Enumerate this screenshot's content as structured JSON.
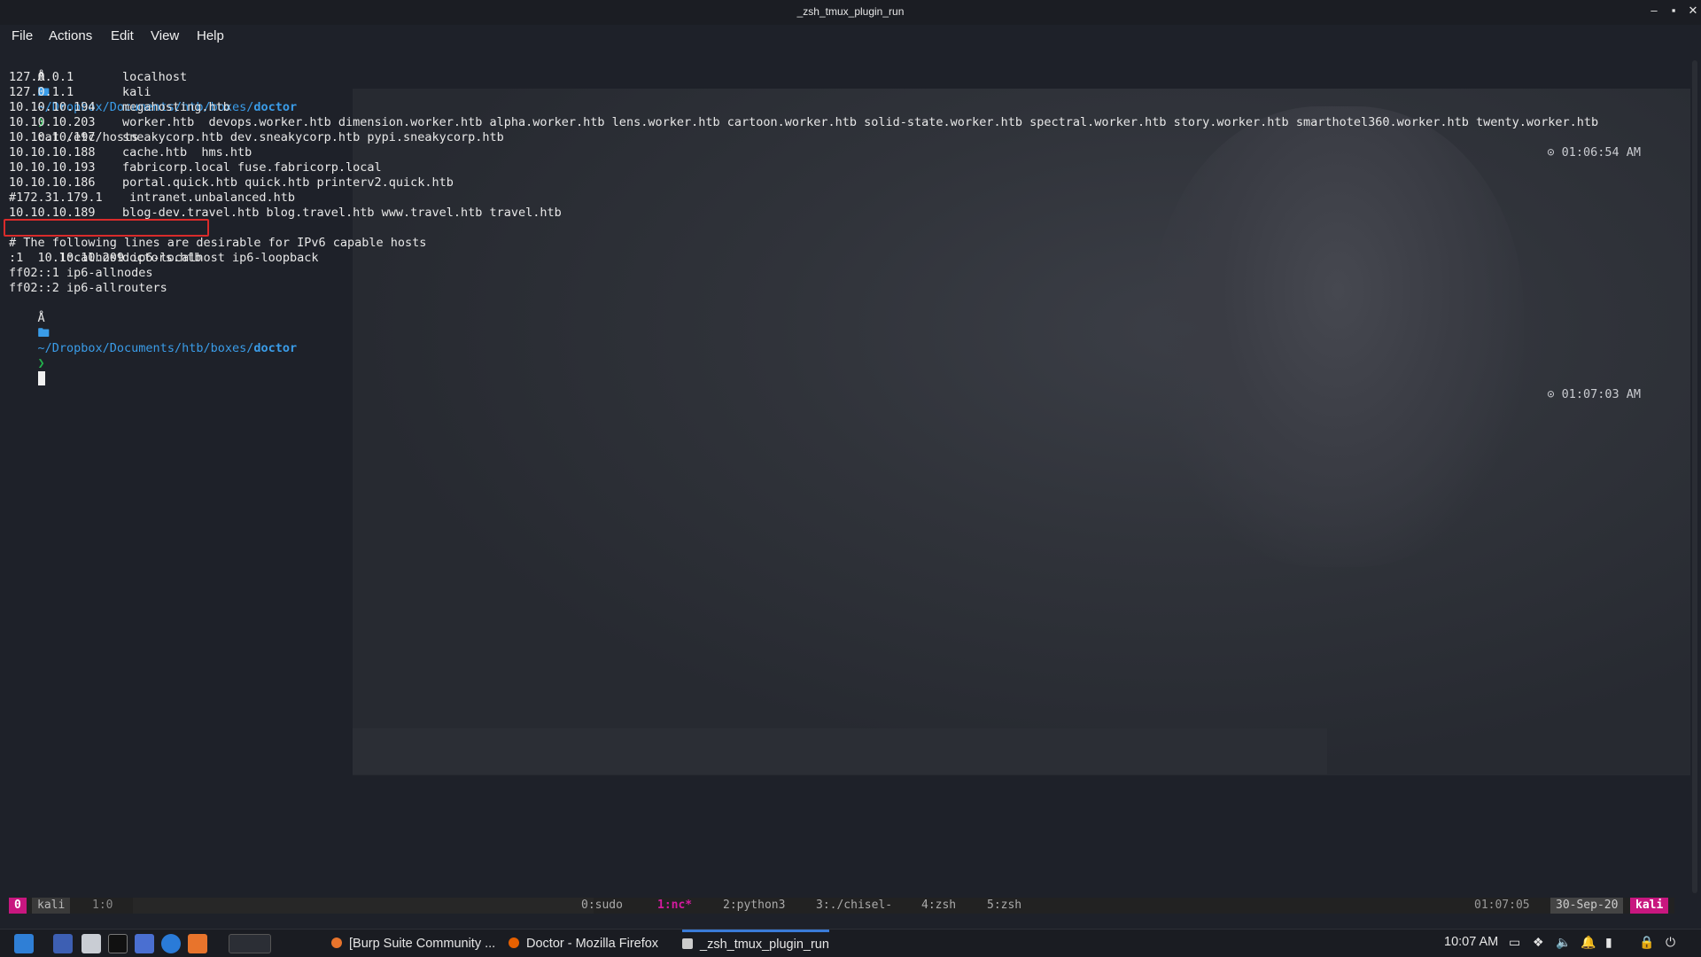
{
  "window": {
    "title": "_zsh_tmux_plugin_run"
  },
  "menu": [
    "File",
    "Actions",
    "Edit",
    "View",
    "Help"
  ],
  "terminal": {
    "prompt1": {
      "symbol": "Å",
      "path": "~/Dropbox/Documents/htb/boxes/",
      "dir": "doctor",
      "command": "cat /etc/hosts",
      "time": "⊙ 01:06:54 AM"
    },
    "hosts": [
      {
        "ip": "127.0.0.1",
        "names": "localhost"
      },
      {
        "ip": "127.0.1.1",
        "names": "kali"
      },
      {
        "ip": "10.10.10.194",
        "names": "megahosting.htb"
      },
      {
        "ip": "10.10.10.203",
        "names": "worker.htb  devops.worker.htb dimension.worker.htb alpha.worker.htb lens.worker.htb cartoon.worker.htb solid-state.worker.htb spectral.worker.htb story.worker.htb smarthotel360.worker.htb twenty.worker.htb"
      },
      {
        "ip": "10.10.10.197",
        "names": "sneakycorp.htb dev.sneakycorp.htb pypi.sneakycorp.htb"
      },
      {
        "ip": "10.10.10.188",
        "names": "cache.htb  hms.htb"
      },
      {
        "ip": "10.10.10.193",
        "names": "fabricorp.local fuse.fabricorp.local"
      },
      {
        "ip": "10.10.10.186",
        "names": "portal.quick.htb quick.htb printerv2.quick.htb"
      },
      {
        "ip": "#172.31.179.1",
        "names": " intranet.unbalanced.htb"
      },
      {
        "ip": "10.10.10.189",
        "names": "blog-dev.travel.htb blog.travel.htb www.travel.htb travel.htb"
      },
      {
        "ip": "10.10.10.209",
        "names": "doctors.htb"
      }
    ],
    "tail_lines": [
      "# The following lines are desirable for IPv6 capable hosts",
      ":1     localhost ip6-localhost ip6-loopback",
      "ff02::1 ip6-allnodes",
      "ff02::2 ip6-allrouters"
    ],
    "prompt2": {
      "symbol": "Å",
      "path": "~/Dropbox/Documents/htb/boxes/",
      "dir": "doctor",
      "time": "⊙ 01:07:03 AM"
    }
  },
  "tmux": {
    "session_index": "0",
    "session_name": "kali",
    "pane": "1:0",
    "windows": [
      {
        "label": "0:sudo",
        "active": false
      },
      {
        "label": "1:nc*",
        "active": true
      },
      {
        "label": "2:python3",
        "active": false
      },
      {
        "label": "3:./chisel-",
        "active": false
      },
      {
        "label": "4:zsh",
        "active": false
      },
      {
        "label": "5:zsh",
        "active": false
      }
    ],
    "time": "01:07:05",
    "date": "30-Sep-20",
    "host": "kali"
  },
  "taskbar": {
    "tasks": [
      {
        "label": "[Burp Suite Community ...",
        "color": "#e8742c"
      },
      {
        "label": "Doctor - Mozilla Firefox",
        "color": "#e66000"
      },
      {
        "label": "_zsh_tmux_plugin_run",
        "color": "#cccccc"
      }
    ],
    "clock": "10:07 AM"
  },
  "colors": {
    "accent_magenta": "#c8177f",
    "highlight_red": "#d92b2b",
    "prompt_blue": "#3a9ce8",
    "prompt_green": "#22b14c"
  }
}
